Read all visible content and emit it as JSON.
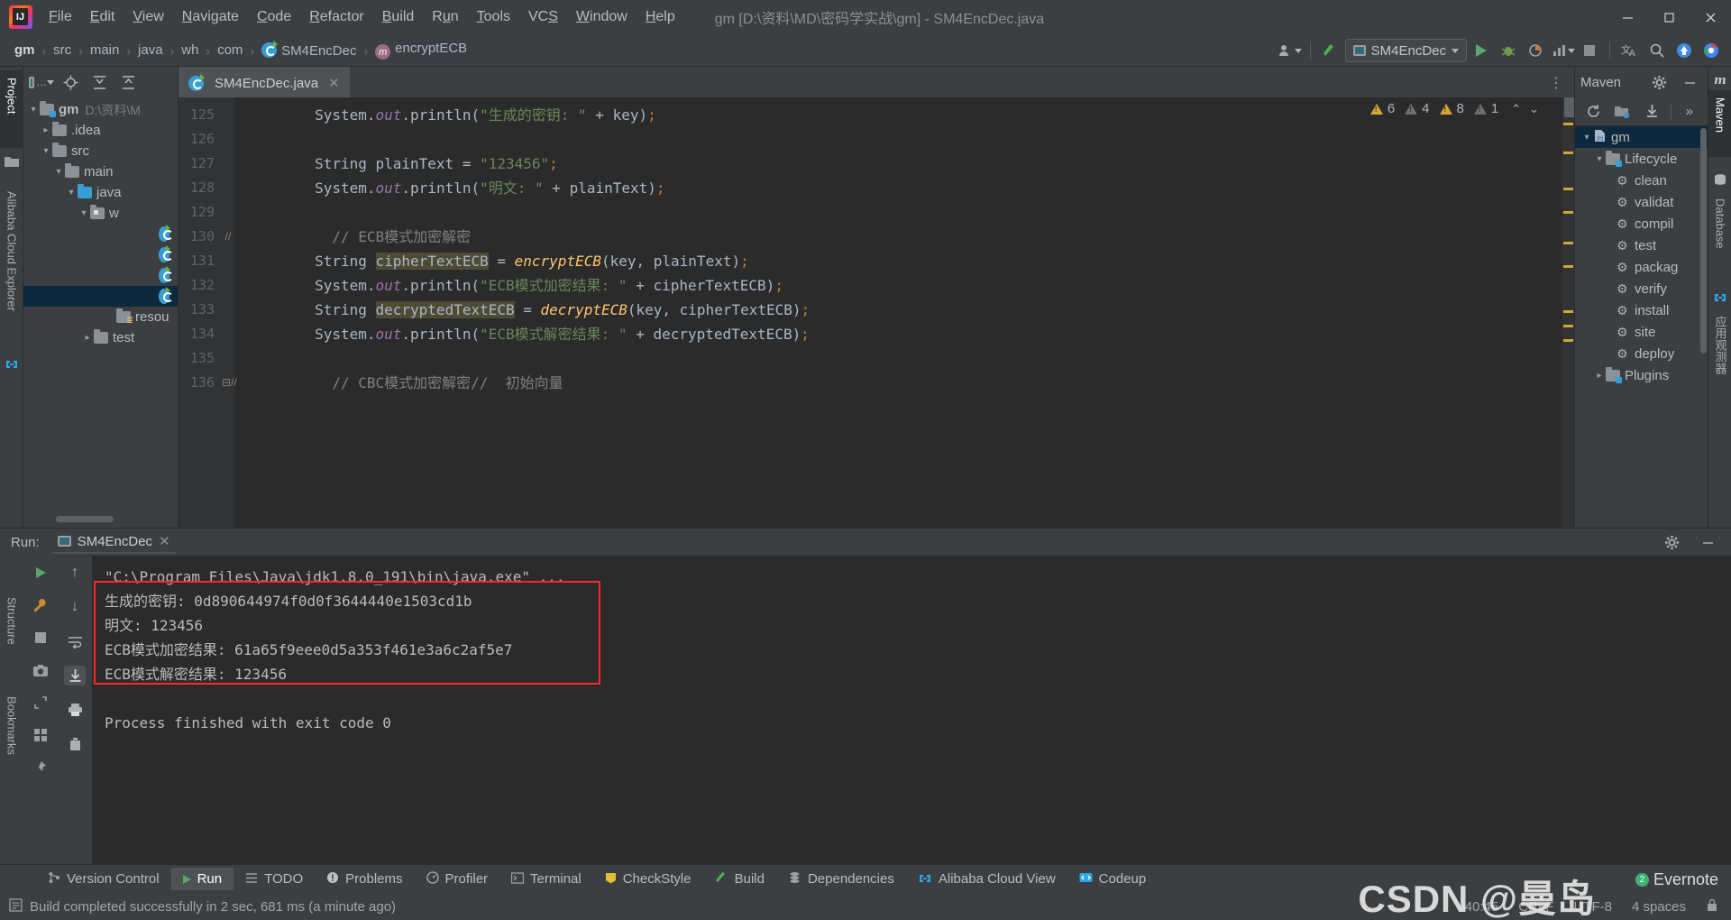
{
  "titlebar": {
    "logo": "intellij-idea-logo",
    "menus": [
      {
        "label": "File",
        "mnemonic": "F"
      },
      {
        "label": "Edit",
        "mnemonic": "E"
      },
      {
        "label": "View",
        "mnemonic": "V"
      },
      {
        "label": "Navigate",
        "mnemonic": "N"
      },
      {
        "label": "Code",
        "mnemonic": "C"
      },
      {
        "label": "Refactor",
        "mnemonic": "R"
      },
      {
        "label": "Build",
        "mnemonic": "B"
      },
      {
        "label": "Run",
        "mnemonic": "u"
      },
      {
        "label": "Tools",
        "mnemonic": "T"
      },
      {
        "label": "VCS",
        "mnemonic": "S"
      },
      {
        "label": "Window",
        "mnemonic": "W"
      },
      {
        "label": "Help",
        "mnemonic": "H"
      }
    ],
    "window_title": "gm [D:\\资料\\MD\\密码学实战\\gm] - SM4EncDec.java",
    "minimize": "–",
    "maximize": "▢",
    "close": "✕"
  },
  "navbar": {
    "breadcrumbs": [
      {
        "label": "gm",
        "icon": "module-icon",
        "bold": true
      },
      {
        "label": "src",
        "icon": "folder-icon",
        "bold": false
      },
      {
        "label": "main",
        "icon": "folder-icon",
        "bold": false
      },
      {
        "label": "java",
        "icon": "folder-icon",
        "bold": false
      },
      {
        "label": "wh",
        "icon": "package-icon",
        "bold": false
      },
      {
        "label": "com",
        "icon": "package-icon",
        "bold": false
      },
      {
        "label": "SM4EncDec",
        "icon": "class-icon",
        "bold": false
      },
      {
        "label": "encryptECB",
        "icon": "method-icon",
        "bold": false
      }
    ],
    "separator": "›",
    "run_config": "SM4EncDec",
    "icons": {
      "user": "user-icon",
      "build": "hammer-icon",
      "run": "run-icon",
      "debug": "debug-icon",
      "coverage": "coverage-icon",
      "profile": "profile-icon",
      "stop": "stop-icon",
      "translate": "translate-icon",
      "search": "search-icon",
      "update": "update-icon",
      "browser": "browser-icon"
    }
  },
  "left_rail": {
    "tabs": [
      {
        "label": "Project",
        "selected": true
      },
      {
        "label": "Alibaba Cloud Explorer",
        "selected": false
      }
    ],
    "bottom_tabs": [
      {
        "label": "Structure",
        "selected": false
      },
      {
        "label": "Bookmarks",
        "selected": false
      }
    ]
  },
  "project_panel": {
    "toolbar": {
      "view_selector": "Project",
      "locate": "locate-icon",
      "expand": "expand-all-icon",
      "collapse": "collapse-all-icon"
    },
    "tree": [
      {
        "label": "gm",
        "detail": "D:\\资料\\M",
        "indent": 0,
        "arrow": "v",
        "icon": "module",
        "bold": true,
        "selected": false
      },
      {
        "label": ".idea",
        "detail": "",
        "indent": 1,
        "arrow": ">",
        "icon": "folder",
        "bold": false,
        "selected": false
      },
      {
        "label": "src",
        "detail": "",
        "indent": 1,
        "arrow": "v",
        "icon": "folder",
        "bold": false,
        "selected": false
      },
      {
        "label": "main",
        "detail": "",
        "indent": 2,
        "arrow": "v",
        "icon": "folder",
        "bold": false,
        "selected": false
      },
      {
        "label": "java",
        "detail": "",
        "indent": 3,
        "arrow": "v",
        "icon": "source",
        "bold": false,
        "selected": false
      },
      {
        "label": "w",
        "detail": "",
        "indent": 4,
        "arrow": "v",
        "icon": "package",
        "bold": false,
        "selected": false
      },
      {
        "label": "",
        "detail": "",
        "indent": 5,
        "arrow": "",
        "icon": "class",
        "bold": false,
        "selected": false
      },
      {
        "label": "",
        "detail": "",
        "indent": 5,
        "arrow": "",
        "icon": "class",
        "bold": false,
        "selected": false
      },
      {
        "label": "",
        "detail": "",
        "indent": 5,
        "arrow": "",
        "icon": "class",
        "bold": false,
        "selected": false
      },
      {
        "label": "",
        "detail": "",
        "indent": 5,
        "arrow": "",
        "icon": "class",
        "bold": false,
        "selected": true
      },
      {
        "label": "resou",
        "detail": "",
        "indent": 3,
        "arrow": "",
        "icon": "resource",
        "bold": false,
        "selected": false
      },
      {
        "label": "test",
        "detail": "",
        "indent": 2,
        "arrow": ">",
        "icon": "folder",
        "bold": false,
        "selected": false
      }
    ]
  },
  "editor": {
    "tab": {
      "label": "SM4EncDec.java",
      "icon": "java-class-icon",
      "close": "✕"
    },
    "overflow": "⋮",
    "inspections": [
      {
        "count": "6",
        "severity": "warning"
      },
      {
        "count": "4",
        "severity": "weak"
      },
      {
        "count": "8",
        "severity": "warning"
      },
      {
        "count": "1",
        "severity": "weak"
      }
    ],
    "nav_up": "⌃",
    "nav_down": "⌄",
    "lines": [
      {
        "num": "125",
        "fold": "",
        "html": "        <s>System</s>.<f>out</f>.println(<str>\"生成的密钥: \"</str> + key)<semi>;</semi>"
      },
      {
        "num": "126",
        "fold": "",
        "html": ""
      },
      {
        "num": "127",
        "fold": "",
        "html": "        String plainText = <str>\"123456\"</str><semi>;</semi>"
      },
      {
        "num": "128",
        "fold": "",
        "html": "        System.out.println(<str>\"明文: \"</str> + plainText);"
      },
      {
        "num": "129",
        "fold": "",
        "html": ""
      },
      {
        "num": "130",
        "fold": "//",
        "html": "        // ECB模式加密解密"
      },
      {
        "num": "131",
        "fold": "",
        "html": "        String cipherTextECB = encryptECB(key, plainText);"
      },
      {
        "num": "132",
        "fold": "",
        "html": "        System.out.println(\"ECB模式加密结果: \" + cipherTextECB);"
      },
      {
        "num": "133",
        "fold": "",
        "html": "        String decryptedTextECB = decryptECB(key, cipherTextECB);"
      },
      {
        "num": "134",
        "fold": "",
        "html": "        System.out.println(\"ECB模式解密结果: \" + decryptedTextECB);"
      },
      {
        "num": "135",
        "fold": "",
        "html": ""
      },
      {
        "num": "136",
        "fold": "//",
        "html": "        // CBC模式加密解密//  初始向量"
      }
    ]
  },
  "maven_panel": {
    "title": "Maven",
    "settings_icon": "gear-icon",
    "hide_icon": "minimize-icon",
    "toolbar": {
      "reload": "reload-icon",
      "add": "add-folder-icon",
      "download": "download-sources-icon",
      "more": "»"
    },
    "tree": [
      {
        "label": "gm",
        "indent": 0,
        "arrow": "v",
        "icon": "maven-project",
        "selected": true
      },
      {
        "label": "Lifecycle",
        "indent": 1,
        "arrow": "v",
        "icon": "lifecycle-folder",
        "selected": false
      },
      {
        "label": "clean",
        "indent": 2,
        "arrow": "",
        "icon": "goal",
        "selected": false
      },
      {
        "label": "validat",
        "indent": 2,
        "arrow": "",
        "icon": "goal",
        "selected": false
      },
      {
        "label": "compil",
        "indent": 2,
        "arrow": "",
        "icon": "goal",
        "selected": false
      },
      {
        "label": "test",
        "indent": 2,
        "arrow": "",
        "icon": "goal",
        "selected": false
      },
      {
        "label": "packag",
        "indent": 2,
        "arrow": "",
        "icon": "goal",
        "selected": false
      },
      {
        "label": "verify",
        "indent": 2,
        "arrow": "",
        "icon": "goal",
        "selected": false
      },
      {
        "label": "install",
        "indent": 2,
        "arrow": "",
        "icon": "goal",
        "selected": false
      },
      {
        "label": "site",
        "indent": 2,
        "arrow": "",
        "icon": "goal",
        "selected": false
      },
      {
        "label": "deploy",
        "indent": 2,
        "arrow": "",
        "icon": "goal",
        "selected": false
      },
      {
        "label": "Plugins",
        "indent": 1,
        "arrow": ">",
        "icon": "plugins-folder",
        "selected": false
      }
    ]
  },
  "right_rail": {
    "tabs": [
      {
        "label": "Maven",
        "selected": true
      },
      {
        "label": "Database",
        "selected": false
      },
      {
        "label": "应用观测器",
        "selected": false
      }
    ]
  },
  "run_panel": {
    "label": "Run:",
    "tab": {
      "label": "SM4EncDec",
      "icon": "run-config-icon",
      "close": "✕"
    },
    "header_icons": {
      "settings": "gear-icon",
      "hide": "minimize-icon"
    },
    "side_buttons": [
      "rerun-icon",
      "wrench-icon",
      "stop-icon",
      "camera-icon",
      "close-icon",
      "expand-icon",
      "layout-icon",
      "pin-icon"
    ],
    "nav_buttons": [
      "up-icon",
      "down-icon",
      "soft-wrap-icon",
      "scroll-end-icon",
      "print-icon",
      "trash-icon"
    ],
    "console": [
      "\"C:\\Program Files\\Java\\jdk1.8.0_191\\bin\\java.exe\" ...",
      "生成的密钥: 0d890644974f0d0f3644440e1503cd1b",
      "明文: 123456",
      "ECB模式加密结果: 61a65f9eee0d5a353f461e3a6c2af5e7",
      "ECB模式解密结果: 123456",
      "",
      "Process finished with exit code 0"
    ],
    "highlight_color": "#fb2828"
  },
  "bottom_bar": {
    "tabs": [
      {
        "label": "Version Control",
        "icon": "branch-icon",
        "selected": false
      },
      {
        "label": "Run",
        "icon": "run-icon",
        "selected": true
      },
      {
        "label": "TODO",
        "icon": "list-icon",
        "selected": false
      },
      {
        "label": "Problems",
        "icon": "error-icon",
        "selected": false
      },
      {
        "label": "Profiler",
        "icon": "profiler-icon",
        "selected": false
      },
      {
        "label": "Terminal",
        "icon": "terminal-icon",
        "selected": false
      },
      {
        "label": "CheckStyle",
        "icon": "checkstyle-icon",
        "selected": false
      },
      {
        "label": "Build",
        "icon": "build-icon",
        "selected": false
      },
      {
        "label": "Dependencies",
        "icon": "dependencies-icon",
        "selected": false
      },
      {
        "label": "Alibaba Cloud View",
        "icon": "cloud-icon",
        "selected": false
      },
      {
        "label": "Codeup",
        "icon": "codeup-icon",
        "selected": false
      }
    ]
  },
  "status_bar": {
    "message": "Build completed successfully in 2 sec, 681 ms (a minute ago)",
    "icon": "build-status-icon",
    "caret": "40:45",
    "line_sep": "CRLF",
    "encoding": "UTF-8",
    "indent": "4 spaces",
    "lock_icon": "lock-icon"
  },
  "watermark": {
    "text": "CSDN @曼岛",
    "badge": "2",
    "sub": "Evernote"
  }
}
